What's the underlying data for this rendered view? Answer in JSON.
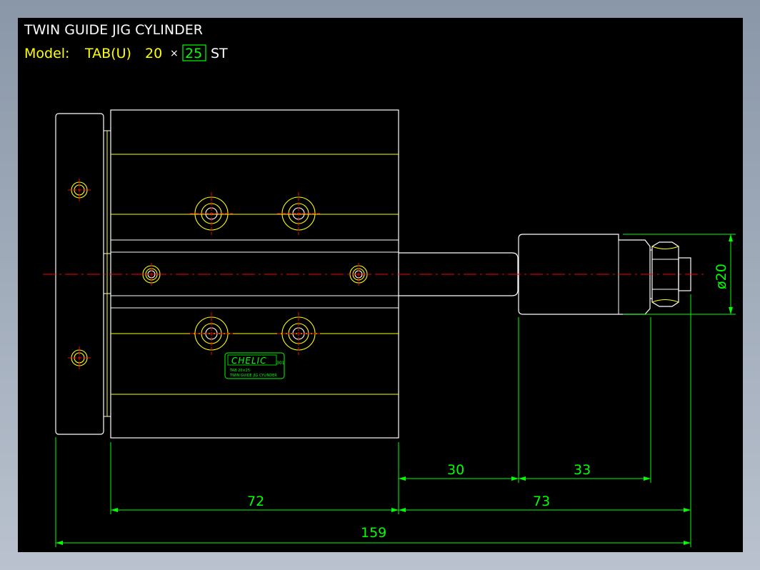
{
  "drawing": {
    "title": "TWIN  GUIDE  JIG  CYLINDER",
    "model_label": "Model:",
    "model_series": "TAB(U)",
    "model_bore": "20",
    "model_times": "×",
    "model_stroke": "25",
    "model_suffix": "ST"
  },
  "nameplate": {
    "brand": "CHELIC",
    "brand_mark": "301",
    "model_line": "TAB  20×25",
    "name_line": "TWIN  GUIDE  JIG  CYLINDER"
  },
  "dimensions": {
    "d30": "30",
    "d33": "33",
    "d72": "72",
    "d73": "73",
    "d159": "159",
    "dia20": "ø20"
  },
  "colors": {
    "background": "#000000",
    "outline": "#ffffff",
    "detail": "#ffff00",
    "dimension": "#00ff00",
    "centerline": "#ff0000"
  }
}
